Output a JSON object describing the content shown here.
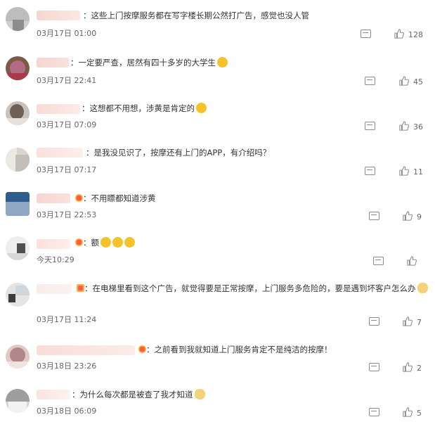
{
  "comments": [
    {
      "text": "这些上门按摩服务都在写字楼长期公然打广告，感觉也没人管",
      "time": "03月17日 01:00",
      "likes": "128"
    },
    {
      "text": "一定要严查，居然有四十多岁的大学生",
      "time": "03月17日 22:41",
      "likes": "45",
      "emoji": "crying-face"
    },
    {
      "text": "这想都不用想，涉黄是肯定的",
      "time": "03月17日 07:09",
      "likes": "36",
      "emoji": "laughing-face"
    },
    {
      "text": "是我没见识了，按摩还有上门的APP，有介绍吗？",
      "time": "03月17日 07:17",
      "likes": "11"
    },
    {
      "text": "不用瞟都知道涉黄",
      "time": "03月17日 22:53",
      "likes": "9",
      "emoji": "badge"
    },
    {
      "text": "额",
      "time": "今天10:29",
      "likes": "",
      "emoji": "sweat-face x3"
    },
    {
      "text": "在电梯里看到这个广告，就觉得要是正常按摩，上门服务多危险的，要是遇到坏客户怎么办",
      "time": "03月17日 11:24",
      "likes": "7",
      "emoji": "doge"
    },
    {
      "text": "之前看到我就知道上门服务肯定不是纯洁的按摩！",
      "time": "03月18日 23:26",
      "likes": "2",
      "emoji": "badge"
    },
    {
      "text": "为什么每次都是被查了我才知道",
      "time": "03月18日 06:09",
      "likes": "5",
      "emoji": "doge"
    }
  ],
  "separator": "：",
  "colors": {
    "text": "#333333",
    "meta": "#666666",
    "icon": "#8a8a8a",
    "emoji": "#f6c22b"
  }
}
